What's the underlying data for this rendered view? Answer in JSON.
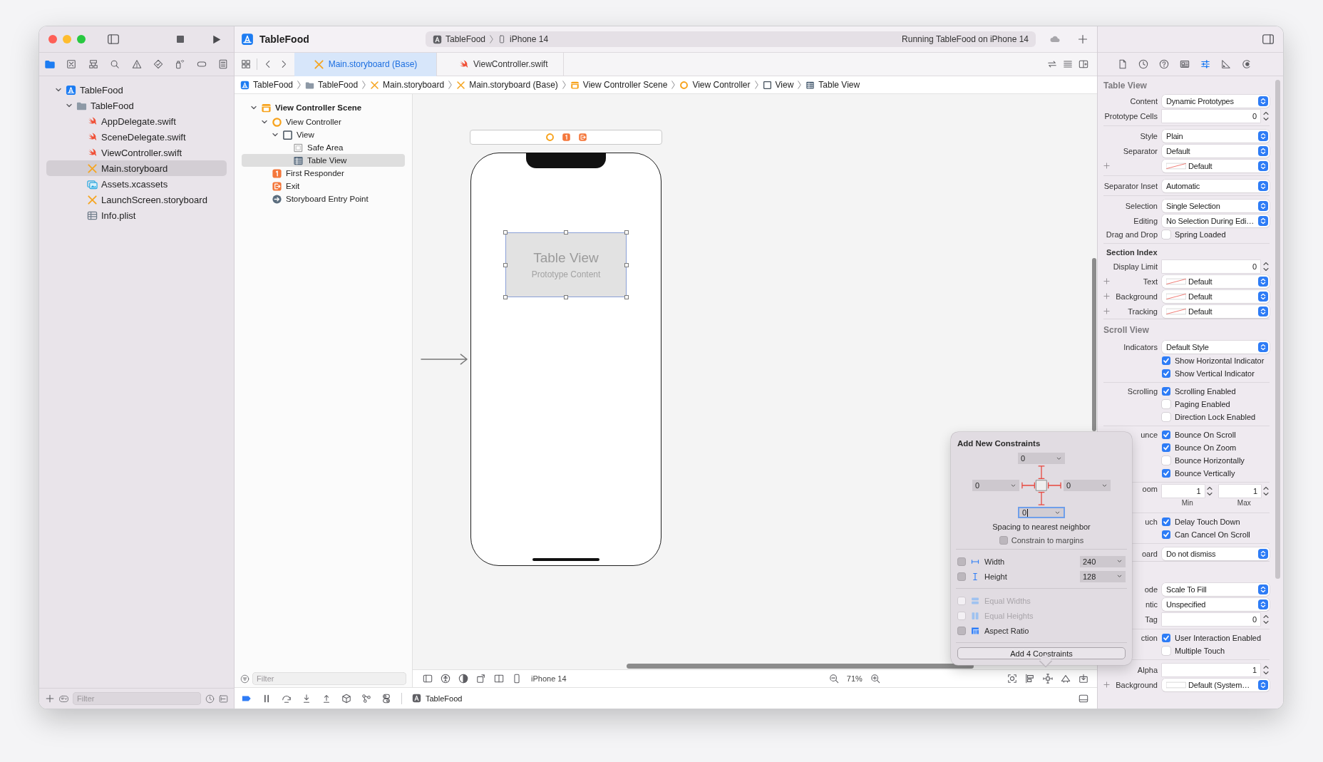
{
  "toolbar": {
    "project": "TableFood",
    "scheme": "TableFood",
    "device": "iPhone 14",
    "status": "Running TableFood on iPhone 14"
  },
  "navigator": {
    "tabs": [
      {
        "kind": "project",
        "selected": true
      },
      {
        "kind": "source-control",
        "selected": false
      },
      {
        "kind": "symbols",
        "selected": false
      },
      {
        "kind": "find",
        "selected": false
      },
      {
        "kind": "issues",
        "selected": false
      },
      {
        "kind": "tests",
        "selected": false
      },
      {
        "kind": "debug",
        "selected": false
      },
      {
        "kind": "breakpoints",
        "selected": false
      },
      {
        "kind": "reports",
        "selected": false
      }
    ],
    "tree": [
      {
        "name": "TableFood",
        "kind": "project",
        "expanded": true,
        "selected": false,
        "children": [
          {
            "name": "TableFood",
            "kind": "folder",
            "expanded": true,
            "selected": false,
            "children": [
              {
                "name": "AppDelegate.swift",
                "kind": "swift",
                "selected": false
              },
              {
                "name": "SceneDelegate.swift",
                "kind": "swift",
                "selected": false
              },
              {
                "name": "ViewController.swift",
                "kind": "swift",
                "selected": false
              },
              {
                "name": "Main.storyboard",
                "kind": "storyboard",
                "selected": true
              },
              {
                "name": "Assets.xcassets",
                "kind": "assets",
                "selected": false
              },
              {
                "name": "LaunchScreen.storyboard",
                "kind": "storyboard",
                "selected": false
              },
              {
                "name": "Info.plist",
                "kind": "plist",
                "selected": false
              }
            ]
          }
        ]
      }
    ],
    "filter": {
      "placeholder": "Filter"
    }
  },
  "tabs": [
    {
      "label": "Main.storyboard (Base)",
      "kind": "storyboard",
      "selected": true
    },
    {
      "label": "ViewController.swift",
      "kind": "swift",
      "selected": false
    }
  ],
  "breadcrumb": [
    {
      "label": "TableFood",
      "kind": "project"
    },
    {
      "label": "TableFood",
      "kind": "folder"
    },
    {
      "label": "Main.storyboard",
      "kind": "storyboard"
    },
    {
      "label": "Main.storyboard (Base)",
      "kind": "storyboard"
    },
    {
      "label": "View Controller Scene",
      "kind": "scene"
    },
    {
      "label": "View Controller",
      "kind": "controller"
    },
    {
      "label": "View",
      "kind": "view"
    },
    {
      "label": "Table View",
      "kind": "table"
    }
  ],
  "outline": {
    "tree": [
      {
        "name": "View Controller Scene",
        "kind": "scene",
        "expanded": true,
        "selected": false,
        "children": [
          {
            "name": "View Controller",
            "kind": "controller",
            "expanded": true,
            "selected": false,
            "children": [
              {
                "name": "View",
                "kind": "view",
                "expanded": true,
                "selected": false,
                "children": [
                  {
                    "name": "Safe Area",
                    "kind": "safe-area",
                    "selected": false
                  },
                  {
                    "name": "Table View",
                    "kind": "table",
                    "selected": true
                  }
                ]
              }
            ]
          },
          {
            "name": "First Responder",
            "kind": "responder",
            "selected": false
          },
          {
            "name": "Exit",
            "kind": "exit",
            "selected": false
          },
          {
            "name": "Storyboard Entry Point",
            "kind": "entry",
            "selected": false
          }
        ]
      }
    ],
    "filter": {
      "placeholder": "Filter"
    }
  },
  "canvas": {
    "table_view": {
      "title": "Table View",
      "subtitle": "Prototype Content"
    },
    "device": "iPhone 14",
    "zoom": "71%"
  },
  "debug_bar": {
    "target": "TableFood"
  },
  "constraints_popover": {
    "title": "Add New Constraints",
    "spacing": [
      {
        "value": "0",
        "focused": false
      },
      {
        "value": "0",
        "focused": false
      },
      {
        "value": "0",
        "focused": false
      },
      {
        "value": "0",
        "focused": true
      }
    ],
    "caption": "Spacing to nearest neighbor",
    "margins": {
      "label": "Constrain to margins",
      "checked": false
    },
    "sizes": [
      {
        "kind": "width",
        "label": "Width",
        "value": "240",
        "checked": false
      },
      {
        "kind": "height",
        "label": "Height",
        "value": "128",
        "checked": false
      }
    ],
    "options": [
      {
        "kind": "equal-widths",
        "label": "Equal Widths",
        "checked": false,
        "disabled": true
      },
      {
        "kind": "equal-heights",
        "label": "Equal Heights",
        "checked": false,
        "disabled": true
      },
      {
        "kind": "aspect-ratio",
        "label": "Aspect Ratio",
        "checked": false,
        "disabled": false
      }
    ],
    "button": "Add 4 Constraints"
  },
  "inspector": {
    "tabs": [
      {
        "kind": "file",
        "selected": false
      },
      {
        "kind": "history",
        "selected": false
      },
      {
        "kind": "help",
        "selected": false
      },
      {
        "kind": "identity",
        "selected": false
      },
      {
        "kind": "attributes",
        "selected": true
      },
      {
        "kind": "size",
        "selected": false
      },
      {
        "kind": "connections",
        "selected": false
      }
    ],
    "sections": [
      {
        "title": "Table View",
        "groups": [
          [
            {
              "kind": "popup",
              "label": "Content",
              "value": "Dynamic Prototypes"
            },
            {
              "kind": "stepper",
              "label": "Prototype Cells",
              "value": "0"
            }
          ],
          [
            {
              "kind": "popup",
              "label": "Style",
              "value": "Plain"
            },
            {
              "kind": "popup",
              "label": "Separator",
              "value": "Default"
            },
            {
              "kind": "color",
              "value": "Default",
              "clear": true
            }
          ],
          [
            {
              "kind": "popup",
              "label": "Separator Inset",
              "value": "Automatic"
            }
          ],
          [
            {
              "kind": "popup",
              "label": "Selection",
              "value": "Single Selection"
            },
            {
              "kind": "popup",
              "label": "Editing",
              "value": "No Selection During Edi…"
            },
            {
              "kind": "checkbox",
              "label": "Drag and Drop",
              "text": "Spring Loaded",
              "checked": false
            }
          ],
          [
            {
              "kind": "subheader",
              "text": "Section Index"
            },
            {
              "kind": "stepper",
              "label": "Display Limit",
              "value": "0"
            },
            {
              "kind": "color",
              "label": "Text",
              "value": "Default",
              "clear": true
            },
            {
              "kind": "color",
              "label": "Background",
              "value": "Default",
              "clear": true
            },
            {
              "kind": "color",
              "label": "Tracking",
              "value": "Default",
              "clear": true
            }
          ]
        ]
      },
      {
        "title": "Scroll View",
        "groups": [
          [
            {
              "kind": "popup",
              "label": "Indicators",
              "value": "Default Style"
            },
            {
              "kind": "checkbox",
              "text": "Show Horizontal Indicator",
              "checked": true
            },
            {
              "kind": "checkbox",
              "text": "Show Vertical Indicator",
              "checked": true
            }
          ],
          [
            {
              "kind": "checkbox",
              "label": "Scrolling",
              "text": "Scrolling Enabled",
              "checked": true
            },
            {
              "kind": "checkbox",
              "text": "Paging Enabled",
              "checked": false
            },
            {
              "kind": "checkbox",
              "text": "Direction Lock Enabled",
              "checked": false
            }
          ],
          [
            {
              "kind": "checkbox",
              "label": "unce",
              "text": "Bounce On Scroll",
              "checked": true
            },
            {
              "kind": "checkbox",
              "text": "Bounce On Zoom",
              "checked": true
            },
            {
              "kind": "checkbox",
              "text": "Bounce Horizontally",
              "checked": false
            },
            {
              "kind": "checkbox",
              "text": "Bounce Vertically",
              "checked": true
            }
          ],
          [
            {
              "kind": "range",
              "label": "oom",
              "min": "1",
              "max": "1",
              "min_caption": "Min",
              "max_caption": "Max"
            }
          ],
          [
            {
              "kind": "checkbox",
              "label": "uch",
              "text": "Delay Touch Down",
              "checked": true
            },
            {
              "kind": "checkbox",
              "text": "Can Cancel On Scroll",
              "checked": true
            }
          ],
          [
            {
              "kind": "popup",
              "label": "oard",
              "value": "Do not dismiss"
            }
          ]
        ]
      },
      {
        "groups": [
          [
            {
              "kind": "popup",
              "label": "ode",
              "value": "Scale To Fill"
            },
            {
              "kind": "popup",
              "label": "ntic",
              "value": "Unspecified"
            },
            {
              "kind": "stepper",
              "label": "Tag",
              "value": "0"
            }
          ],
          [
            {
              "kind": "checkbox",
              "label": "ction",
              "text": "User Interaction Enabled",
              "checked": true
            },
            {
              "kind": "checkbox",
              "text": "Multiple Touch",
              "checked": false
            }
          ],
          [
            {
              "kind": "stepper",
              "label": "Alpha",
              "value": "1"
            },
            {
              "kind": "color",
              "label": "Background",
              "value": "Default (System…",
              "clear": false
            }
          ]
        ]
      }
    ]
  }
}
